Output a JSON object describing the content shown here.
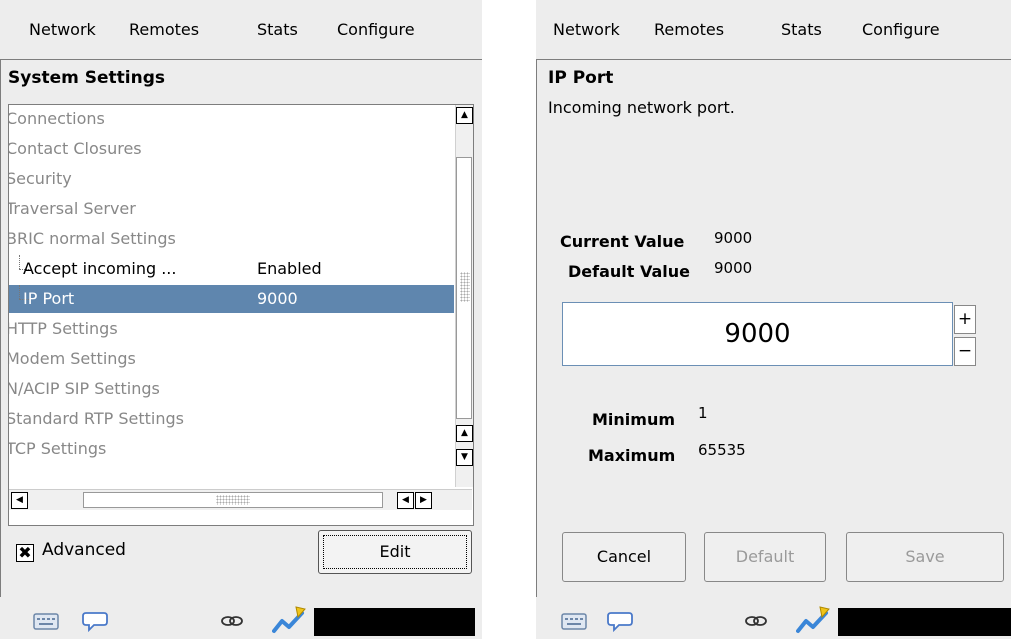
{
  "left": {
    "menu": [
      "Network",
      "Remotes",
      "Stats",
      "Configure"
    ],
    "title": "System Settings",
    "tree": [
      {
        "label": "Connections",
        "value": ""
      },
      {
        "label": "Contact Closures",
        "value": ""
      },
      {
        "label": "Security",
        "value": ""
      },
      {
        "label": "Traversal Server",
        "value": ""
      },
      {
        "label": "BRIC normal Settings",
        "value": ""
      },
      {
        "label": "Accept incoming ...",
        "value": "Enabled"
      },
      {
        "label": "IP Port",
        "value": "9000"
      },
      {
        "label": "HTTP Settings",
        "value": ""
      },
      {
        "label": "Modem Settings",
        "value": ""
      },
      {
        "label": "N/ACIP SIP Settings",
        "value": ""
      },
      {
        "label": "Standard RTP Settings",
        "value": ""
      },
      {
        "label": "TCP Settings",
        "value": ""
      }
    ],
    "advanced_label": "Advanced",
    "advanced_checked": true,
    "edit_label": "Edit"
  },
  "right": {
    "menu": [
      "Network",
      "Remotes",
      "Stats",
      "Configure"
    ],
    "title": "IP Port",
    "description": "Incoming network port.",
    "current_label": "Current Value",
    "current_value": "9000",
    "default_label": "Default Value",
    "default_value": "9000",
    "field_value": "9000",
    "plus": "+",
    "minus": "−",
    "min_label": "Minimum",
    "min_value": "1",
    "max_label": "Maximum",
    "max_value": "65535",
    "cancel_label": "Cancel",
    "default_button_label": "Default",
    "save_label": "Save"
  },
  "colors": {
    "selection": "#5f86ae",
    "panel_bg": "#ededed"
  },
  "icons": {
    "status": [
      "keyboard-icon",
      "chat-bubble-icon",
      "link-icon",
      "signal-graph-icon"
    ]
  }
}
